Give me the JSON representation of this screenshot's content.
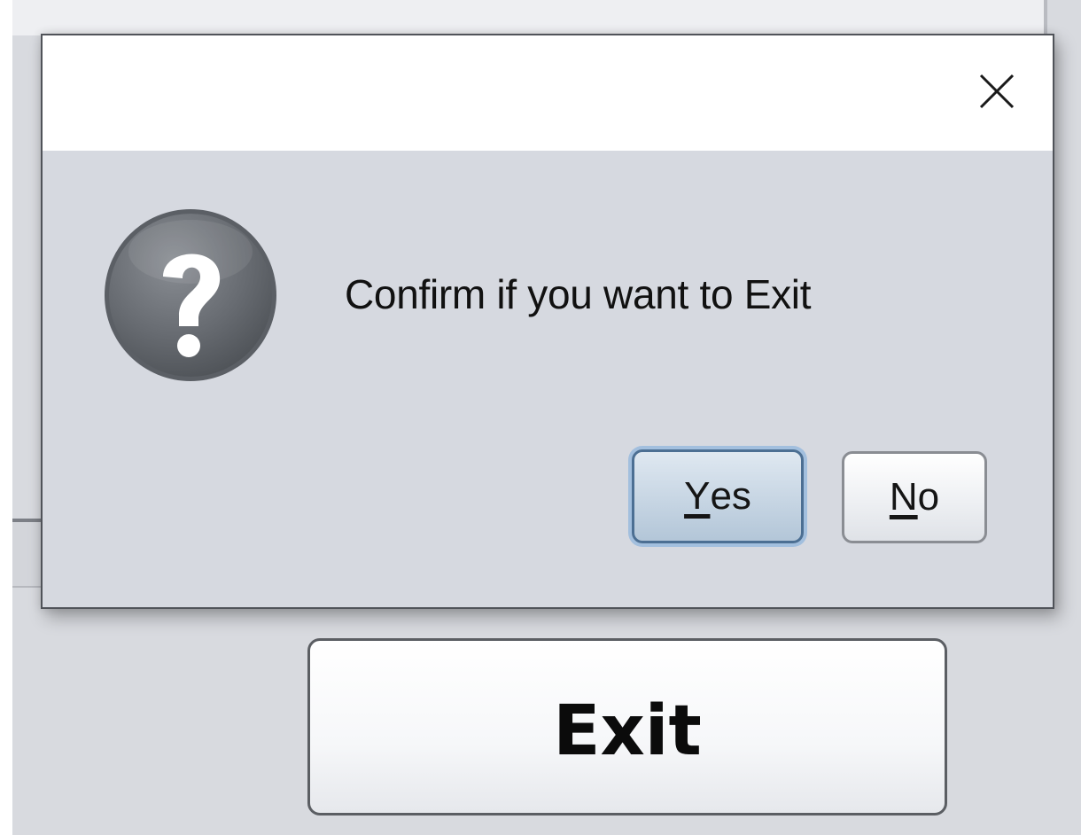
{
  "dialog": {
    "message": "Confirm if you want to Exit",
    "icon": "question-icon",
    "close_icon": "close-icon",
    "buttons": {
      "yes": {
        "mnemonic": "Y",
        "rest": "es"
      },
      "no": {
        "mnemonic": "N",
        "rest": "o"
      }
    }
  },
  "app": {
    "exit_label": "Exit"
  },
  "colors": {
    "dialog_body": "#d6d9e0",
    "titlebar": "#ffffff",
    "default_button_border": "#4c6f93",
    "icon_gray": "#6f7378"
  }
}
